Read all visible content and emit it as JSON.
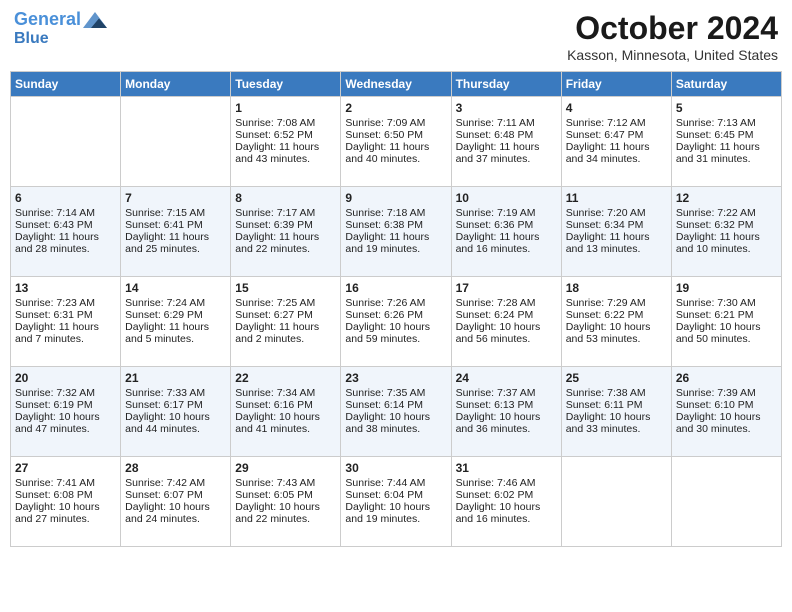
{
  "header": {
    "logo_line1": "General",
    "logo_line2": "Blue",
    "month": "October 2024",
    "location": "Kasson, Minnesota, United States"
  },
  "weekdays": [
    "Sunday",
    "Monday",
    "Tuesday",
    "Wednesday",
    "Thursday",
    "Friday",
    "Saturday"
  ],
  "weeks": [
    [
      {
        "day": "",
        "info": ""
      },
      {
        "day": "",
        "info": ""
      },
      {
        "day": "1",
        "info": "Sunrise: 7:08 AM\nSunset: 6:52 PM\nDaylight: 11 hours and 43 minutes."
      },
      {
        "day": "2",
        "info": "Sunrise: 7:09 AM\nSunset: 6:50 PM\nDaylight: 11 hours and 40 minutes."
      },
      {
        "day": "3",
        "info": "Sunrise: 7:11 AM\nSunset: 6:48 PM\nDaylight: 11 hours and 37 minutes."
      },
      {
        "day": "4",
        "info": "Sunrise: 7:12 AM\nSunset: 6:47 PM\nDaylight: 11 hours and 34 minutes."
      },
      {
        "day": "5",
        "info": "Sunrise: 7:13 AM\nSunset: 6:45 PM\nDaylight: 11 hours and 31 minutes."
      }
    ],
    [
      {
        "day": "6",
        "info": "Sunrise: 7:14 AM\nSunset: 6:43 PM\nDaylight: 11 hours and 28 minutes."
      },
      {
        "day": "7",
        "info": "Sunrise: 7:15 AM\nSunset: 6:41 PM\nDaylight: 11 hours and 25 minutes."
      },
      {
        "day": "8",
        "info": "Sunrise: 7:17 AM\nSunset: 6:39 PM\nDaylight: 11 hours and 22 minutes."
      },
      {
        "day": "9",
        "info": "Sunrise: 7:18 AM\nSunset: 6:38 PM\nDaylight: 11 hours and 19 minutes."
      },
      {
        "day": "10",
        "info": "Sunrise: 7:19 AM\nSunset: 6:36 PM\nDaylight: 11 hours and 16 minutes."
      },
      {
        "day": "11",
        "info": "Sunrise: 7:20 AM\nSunset: 6:34 PM\nDaylight: 11 hours and 13 minutes."
      },
      {
        "day": "12",
        "info": "Sunrise: 7:22 AM\nSunset: 6:32 PM\nDaylight: 11 hours and 10 minutes."
      }
    ],
    [
      {
        "day": "13",
        "info": "Sunrise: 7:23 AM\nSunset: 6:31 PM\nDaylight: 11 hours and 7 minutes."
      },
      {
        "day": "14",
        "info": "Sunrise: 7:24 AM\nSunset: 6:29 PM\nDaylight: 11 hours and 5 minutes."
      },
      {
        "day": "15",
        "info": "Sunrise: 7:25 AM\nSunset: 6:27 PM\nDaylight: 11 hours and 2 minutes."
      },
      {
        "day": "16",
        "info": "Sunrise: 7:26 AM\nSunset: 6:26 PM\nDaylight: 10 hours and 59 minutes."
      },
      {
        "day": "17",
        "info": "Sunrise: 7:28 AM\nSunset: 6:24 PM\nDaylight: 10 hours and 56 minutes."
      },
      {
        "day": "18",
        "info": "Sunrise: 7:29 AM\nSunset: 6:22 PM\nDaylight: 10 hours and 53 minutes."
      },
      {
        "day": "19",
        "info": "Sunrise: 7:30 AM\nSunset: 6:21 PM\nDaylight: 10 hours and 50 minutes."
      }
    ],
    [
      {
        "day": "20",
        "info": "Sunrise: 7:32 AM\nSunset: 6:19 PM\nDaylight: 10 hours and 47 minutes."
      },
      {
        "day": "21",
        "info": "Sunrise: 7:33 AM\nSunset: 6:17 PM\nDaylight: 10 hours and 44 minutes."
      },
      {
        "day": "22",
        "info": "Sunrise: 7:34 AM\nSunset: 6:16 PM\nDaylight: 10 hours and 41 minutes."
      },
      {
        "day": "23",
        "info": "Sunrise: 7:35 AM\nSunset: 6:14 PM\nDaylight: 10 hours and 38 minutes."
      },
      {
        "day": "24",
        "info": "Sunrise: 7:37 AM\nSunset: 6:13 PM\nDaylight: 10 hours and 36 minutes."
      },
      {
        "day": "25",
        "info": "Sunrise: 7:38 AM\nSunset: 6:11 PM\nDaylight: 10 hours and 33 minutes."
      },
      {
        "day": "26",
        "info": "Sunrise: 7:39 AM\nSunset: 6:10 PM\nDaylight: 10 hours and 30 minutes."
      }
    ],
    [
      {
        "day": "27",
        "info": "Sunrise: 7:41 AM\nSunset: 6:08 PM\nDaylight: 10 hours and 27 minutes."
      },
      {
        "day": "28",
        "info": "Sunrise: 7:42 AM\nSunset: 6:07 PM\nDaylight: 10 hours and 24 minutes."
      },
      {
        "day": "29",
        "info": "Sunrise: 7:43 AM\nSunset: 6:05 PM\nDaylight: 10 hours and 22 minutes."
      },
      {
        "day": "30",
        "info": "Sunrise: 7:44 AM\nSunset: 6:04 PM\nDaylight: 10 hours and 19 minutes."
      },
      {
        "day": "31",
        "info": "Sunrise: 7:46 AM\nSunset: 6:02 PM\nDaylight: 10 hours and 16 minutes."
      },
      {
        "day": "",
        "info": ""
      },
      {
        "day": "",
        "info": ""
      }
    ]
  ]
}
